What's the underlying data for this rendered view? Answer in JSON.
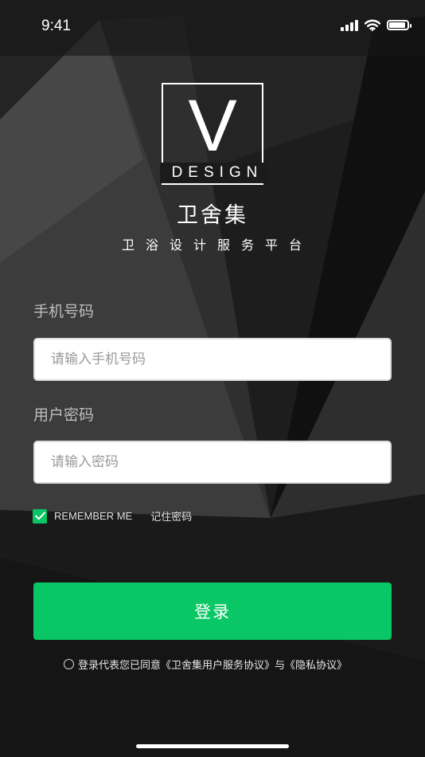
{
  "status_bar": {
    "time": "9:41",
    "battery_level": 0.9
  },
  "logo": {
    "letter": "V",
    "word": "DESIGN"
  },
  "brand": {
    "name": "卫舍集",
    "tagline": "卫浴设计服务平台"
  },
  "form": {
    "phone_label": "手机号码",
    "phone_placeholder": "请输入手机号码",
    "phone_value": "",
    "password_label": "用户密码",
    "password_placeholder": "请输入密码",
    "password_value": "",
    "remember_checked": true,
    "remember_en": "REMEMBER ME",
    "remember_cn": "记住密码"
  },
  "login_button": "登录",
  "agreement": {
    "checked": false,
    "text": "登录代表您已同意《卫舍集用户服务协议》与《隐私协议》"
  },
  "colors": {
    "accent": "#09c764",
    "background": "#1c1c1c",
    "text": "#ffffff",
    "label": "#bdbdbd"
  }
}
